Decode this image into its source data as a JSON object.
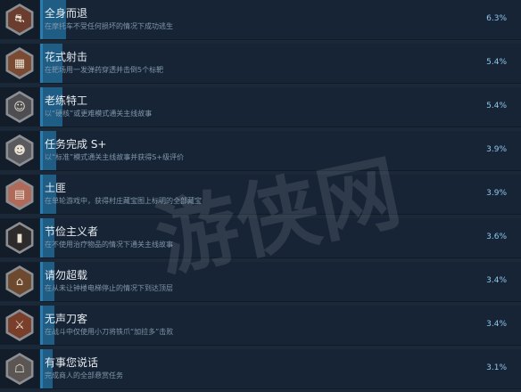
{
  "achievements": [
    {
      "title": "全身而退",
      "desc": "在摩托车不受任何损坏的情况下成功逃生",
      "percent": "6.3%",
      "icon": "motorcycle-escape-icon",
      "icon_color": "#6a3d2e",
      "fill": 0.063
    },
    {
      "title": "花式射击",
      "desc": "在靶场用一发弹药穿透并击倒5个标靶",
      "percent": "5.4%",
      "icon": "shooting-range-icon",
      "icon_color": "#7a4a33",
      "fill": 0.054
    },
    {
      "title": "老练特工",
      "desc": "以“硬核”或更难模式通关主线故事",
      "percent": "5.4%",
      "icon": "agent-portrait-icon",
      "icon_color": "#4e4e52",
      "fill": 0.054
    },
    {
      "title": "任务完成 S+",
      "desc": "以“标准”模式通关主线故事并获得S+级评价",
      "percent": "3.9%",
      "icon": "s-plus-rank-icon",
      "icon_color": "#5a5a5e",
      "fill": 0.039
    },
    {
      "title": "土匪",
      "desc": "在单轮游戏中，获得村庄藏宝图上标明的全部藏宝",
      "percent": "3.9%",
      "icon": "treasure-map-icon",
      "icon_color": "#b06a5a",
      "fill": 0.039
    },
    {
      "title": "节俭主义者",
      "desc": "在不使用治疗物品的情况下通关主线故事",
      "percent": "3.6%",
      "icon": "dark-door-icon",
      "icon_color": "#2c2a2a",
      "fill": 0.036
    },
    {
      "title": "请勿超载",
      "desc": "在从未让钟楼电梯停止的情况下到达顶层",
      "percent": "3.4%",
      "icon": "clock-tower-elevator-icon",
      "icon_color": "#6d4a2f",
      "fill": 0.034
    },
    {
      "title": "无声刀客",
      "desc": "在战斗中仅使用小刀将铁爪“加拉多”击败",
      "percent": "3.4%",
      "icon": "knife-fighter-icon",
      "icon_color": "#7a3f2a",
      "fill": 0.034
    },
    {
      "title": "有事您说话",
      "desc": "完成商人的全部悬赏任务",
      "percent": "3.1%",
      "icon": "merchant-icon",
      "icon_color": "#5b5654",
      "fill": 0.031
    }
  ],
  "watermark": {
    "text": "游侠网"
  }
}
